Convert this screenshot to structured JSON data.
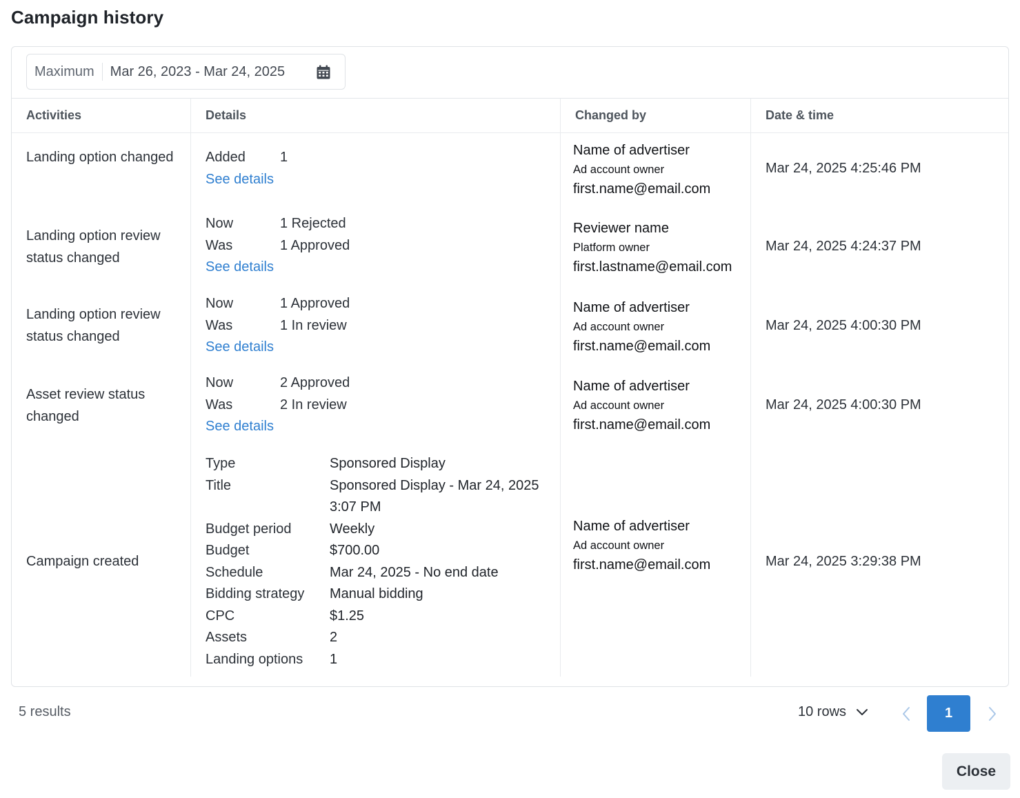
{
  "title": "Campaign history",
  "date_filter": {
    "preset": "Maximum",
    "range": "Mar 26, 2023 - Mar 24, 2025",
    "icon": "calendar-icon"
  },
  "table": {
    "headers": {
      "activities": "Activities",
      "details": "Details",
      "changed_by": "Changed by",
      "date_time": "Date & time"
    },
    "rows": [
      {
        "activity": "Landing option changed",
        "details": [
          {
            "k": "Added",
            "v": "1"
          }
        ],
        "link": "See details",
        "changed_by": {
          "name": "Name of advertiser",
          "role": "Ad account owner",
          "email": "first.name@email.com"
        },
        "datetime": "Mar 24, 2025 4:25:46 PM"
      },
      {
        "activity": "Landing option review status changed",
        "details": [
          {
            "k": "Now",
            "v": "1 Rejected"
          },
          {
            "k": "Was",
            "v": "1 Approved"
          }
        ],
        "link": "See details",
        "changed_by": {
          "name": "Reviewer name",
          "role": "Platform owner",
          "email": "first.lastname@email.com"
        },
        "datetime": "Mar 24, 2025 4:24:37 PM"
      },
      {
        "activity": "Landing option review status changed",
        "details": [
          {
            "k": "Now",
            "v": "1 Approved"
          },
          {
            "k": "Was",
            "v": "1 In review"
          }
        ],
        "link": "See details",
        "changed_by": {
          "name": "Name of advertiser",
          "role": "Ad account owner",
          "email": "first.name@email.com"
        },
        "datetime": "Mar 24, 2025 4:00:30 PM"
      },
      {
        "activity": "Asset review status changed",
        "details": [
          {
            "k": "Now",
            "v": "2 Approved"
          },
          {
            "k": "Was",
            "v": "2 In review"
          }
        ],
        "link": "See details",
        "changed_by": {
          "name": "Name of advertiser",
          "role": "Ad account owner",
          "email": "first.name@email.com"
        },
        "datetime": "Mar 24, 2025 4:00:30 PM"
      },
      {
        "activity": "Campaign created",
        "details": [
          {
            "k": "Type",
            "v": "Sponsored Display"
          },
          {
            "k": "Title",
            "v": "Sponsored Display - Mar 24, 2025 3:07 PM"
          },
          {
            "k": "Budget period",
            "v": "Weekly"
          },
          {
            "k": "Budget",
            "v": "$700.00"
          },
          {
            "k": "Schedule",
            "v": "Mar 24, 2025 - No end date"
          },
          {
            "k": "Bidding strategy",
            "v": "Manual bidding"
          },
          {
            "k": "CPC",
            "v": "$1.25"
          }
        ],
        "link_details": [
          {
            "k": "Assets",
            "v": "2"
          },
          {
            "k": "Landing options",
            "v": "1"
          }
        ],
        "changed_by": {
          "name": "Name of advertiser",
          "role": "Ad account owner",
          "email": "first.name@email.com"
        },
        "datetime": "Mar 24, 2025 3:29:38 PM"
      }
    ]
  },
  "footer": {
    "results": "5 results",
    "rows_per_page": "10 rows",
    "current_page": "1",
    "close_label": "Close"
  },
  "colors": {
    "accent": "#2f7fd0",
    "border": "#dfe2e6"
  }
}
